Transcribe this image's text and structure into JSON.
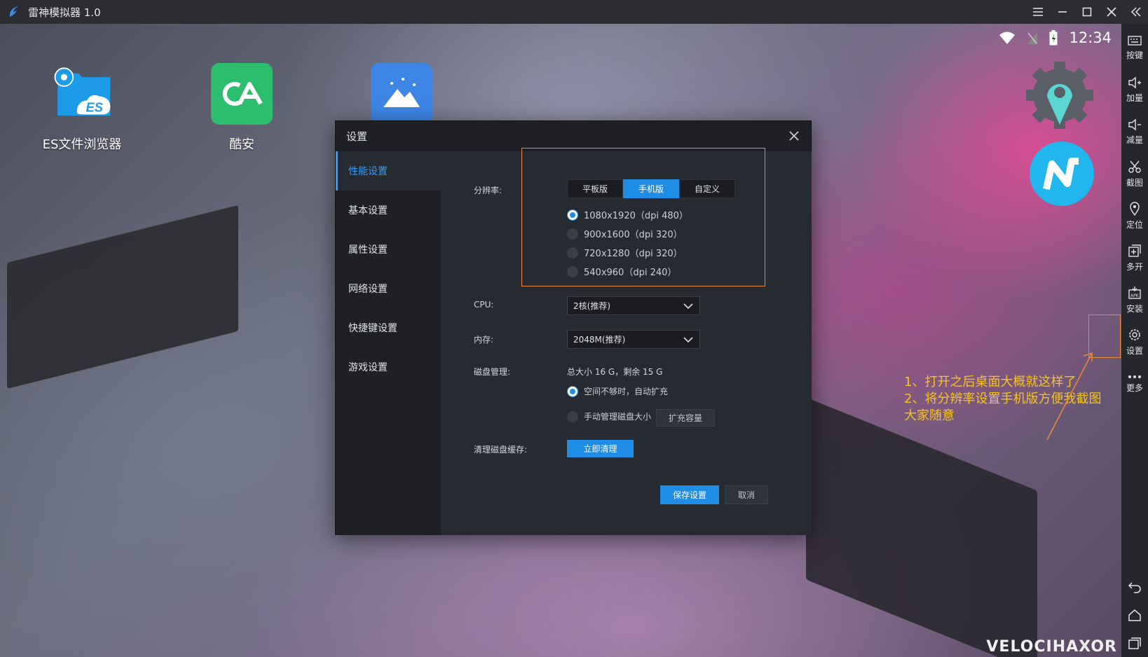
{
  "titlebar": {
    "app_title": "雷神模拟器 1.0",
    "controls": [
      "menu-icon",
      "minimize-icon",
      "maximize-icon",
      "close-icon",
      "collapse-icon"
    ]
  },
  "status_bar": {
    "time": "12:34",
    "icons": [
      "wifi-icon",
      "no-signal-icon",
      "battery-charging-icon"
    ]
  },
  "desktop": {
    "apps": [
      {
        "label": "ES文件浏览器",
        "icon": "es-file-browser-icon",
        "color": "#1e9be8"
      },
      {
        "label": "酷安",
        "icon": "coolapk-icon",
        "color": "#2dbd6e"
      },
      {
        "label": "",
        "icon": "gallery-icon",
        "color": "#3d86e6"
      }
    ],
    "floating_icons": [
      "settings-gear-icon",
      "n-app-icon"
    ],
    "annotation": {
      "line1": "1、打开之后桌面大概就这样了",
      "line2": "2、将分辨率设置手机版方便我截图",
      "line3": "大家随意"
    },
    "watermark": "VELOCIHAXOR"
  },
  "sidebar": {
    "items": [
      {
        "label": "按键",
        "icon": "keyboard-icon"
      },
      {
        "label": "加量",
        "icon": "volume-up-icon"
      },
      {
        "label": "减量",
        "icon": "volume-down-icon"
      },
      {
        "label": "截图",
        "icon": "scissors-icon"
      },
      {
        "label": "定位",
        "icon": "location-icon"
      },
      {
        "label": "多开",
        "icon": "multi-instance-icon"
      },
      {
        "label": "安装",
        "icon": "apk-install-icon"
      },
      {
        "label": "设置",
        "icon": "gear-icon"
      },
      {
        "label": "更多",
        "icon": "more-icon"
      }
    ],
    "nav": [
      "back-icon",
      "home-icon",
      "recents-icon"
    ]
  },
  "dialog": {
    "title": "设置",
    "nav": [
      "性能设置",
      "基本设置",
      "属性设置",
      "网络设置",
      "快捷键设置",
      "游戏设置"
    ],
    "active_nav": 0,
    "resolution": {
      "label": "分辨率:",
      "modes": [
        "平板版",
        "手机版",
        "自定义"
      ],
      "active_mode": 1,
      "options": [
        "1080x1920（dpi 480）",
        "900x1600（dpi 320）",
        "720x1280（dpi 320）",
        "540x960（dpi 240）"
      ],
      "selected_option": 0
    },
    "cpu": {
      "label": "CPU:",
      "value": "2核(推荐)"
    },
    "memory": {
      "label": "内存:",
      "value": "2048M(推荐)"
    },
    "disk": {
      "label": "磁盘管理:",
      "summary": "总大小 16 G，剩余 15 G",
      "auto_expand": "空间不够时，自动扩充",
      "manual": "手动管理磁盘大小",
      "expand_button": "扩充容量"
    },
    "cache": {
      "label": "清理磁盘缓存:",
      "button": "立即清理"
    },
    "save_button": "保存设置",
    "cancel_button": "取消"
  }
}
